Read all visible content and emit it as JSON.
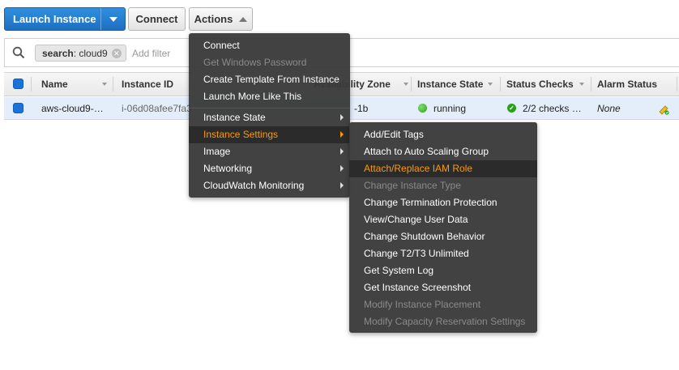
{
  "toolbar": {
    "launch_label": "Launch Instance",
    "connect_label": "Connect",
    "actions_label": "Actions"
  },
  "filter": {
    "chip_key": "search",
    "chip_value": " : cloud9",
    "placeholder": "Add filter"
  },
  "table": {
    "columns": [
      "Name",
      "Instance ID",
      "Availability Zone",
      "Instance State",
      "Status Checks",
      "Alarm Status"
    ],
    "row": {
      "name": "aws-cloud9-…",
      "instance_id": "i-06d08afee7fa3",
      "zone": "-1b",
      "state": "running",
      "status_checks": "2/2 checks …",
      "alarm_status": "None"
    }
  },
  "actions_menu": {
    "items": [
      {
        "label": "Connect",
        "disabled": false
      },
      {
        "label": "Get Windows Password",
        "disabled": true
      },
      {
        "label": "Create Template From Instance",
        "disabled": false
      },
      {
        "label": "Launch More Like This",
        "disabled": false
      },
      {
        "label": "Instance State",
        "submenu": true
      },
      {
        "label": "Instance Settings",
        "submenu": true,
        "active": true
      },
      {
        "label": "Image",
        "submenu": true
      },
      {
        "label": "Networking",
        "submenu": true
      },
      {
        "label": "CloudWatch Monitoring",
        "submenu": true
      }
    ]
  },
  "settings_menu": {
    "items": [
      {
        "label": "Add/Edit Tags",
        "disabled": false
      },
      {
        "label": "Attach to Auto Scaling Group",
        "disabled": false
      },
      {
        "label": "Attach/Replace IAM Role",
        "disabled": false,
        "highlighted": true
      },
      {
        "label": "Change Instance Type",
        "disabled": true
      },
      {
        "label": "Change Termination Protection",
        "disabled": false
      },
      {
        "label": "View/Change User Data",
        "disabled": false
      },
      {
        "label": "Change Shutdown Behavior",
        "disabled": false
      },
      {
        "label": "Change T2/T3 Unlimited",
        "disabled": false
      },
      {
        "label": "Get System Log",
        "disabled": false
      },
      {
        "label": "Get Instance Screenshot",
        "disabled": false
      },
      {
        "label": "Modify Instance Placement",
        "disabled": true
      },
      {
        "label": "Modify Capacity Reservation Settings",
        "disabled": true
      }
    ]
  },
  "colors": {
    "accent_blue": "#1e6fc0",
    "highlight_orange": "#ff9900",
    "running_green": "#2aa018"
  }
}
